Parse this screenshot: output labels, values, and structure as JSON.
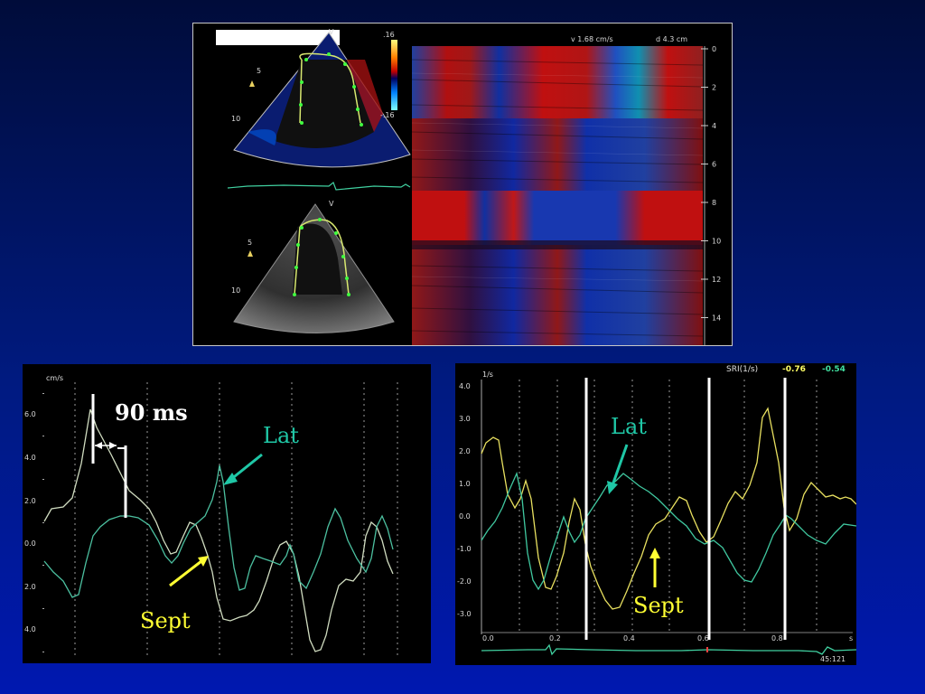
{
  "top": {
    "velocity_label": "v 1.68 cm/s",
    "depth_label": "d 4.3 cm",
    "scale_top": ".16",
    "scale_bottom": "-.16",
    "sector_marker": "V",
    "depth_ticks": [
      "0",
      "2",
      "4",
      "6",
      "8",
      "10",
      "12",
      "14",
      "0"
    ],
    "echo_ticks": [
      "5",
      "10"
    ]
  },
  "left_chart": {
    "unit": "cm/s",
    "y_ticks": [
      "6.0",
      "4.0",
      "2.0",
      "0.0",
      "2.0",
      "4.0"
    ],
    "annotation_ms": "90 ms",
    "label_lat": "Lat",
    "label_sept": "Sept",
    "colors": {
      "lat": "#1fc7a6",
      "sept": "#ffff33",
      "trace_light": "#d8e4b8",
      "trace_teal": "#5fc0a8"
    }
  },
  "right_chart": {
    "unit": "1/s",
    "header": "SRI(1/s)",
    "value_yellow": "-0.76",
    "value_green": "-0.54",
    "y_ticks": [
      "4.0",
      "3.0",
      "2.0",
      "1.0",
      "0.0",
      "-1.0",
      "-2.0",
      "-3.0"
    ],
    "x_ticks": [
      "0.0",
      "0.2",
      "0.4",
      "0.6",
      "0.8"
    ],
    "x_unit": "s",
    "frame_counter": "45:121",
    "label_lat": "Lat",
    "label_sept": "Sept",
    "colors": {
      "lat": "#1fc7a6",
      "sept": "#ffff33",
      "yellow_trace": "#e8e060",
      "green_trace": "#40c8a0"
    }
  }
}
